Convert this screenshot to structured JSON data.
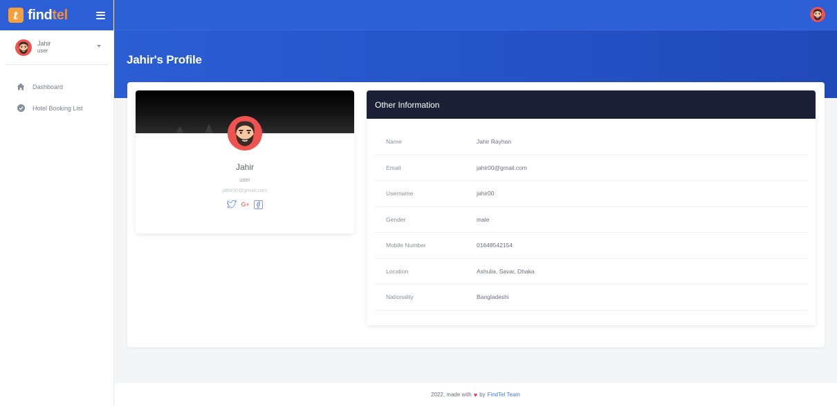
{
  "brand": {
    "logo_letter": "t",
    "name_part1": "find",
    "name_part2": "tel"
  },
  "sidebar": {
    "user": {
      "name": "Jahir",
      "role": "user"
    },
    "items": [
      {
        "label": "Dashboard",
        "icon": "home-icon"
      },
      {
        "label": "Hotel Booking List",
        "icon": "check-circle-icon"
      }
    ]
  },
  "header": {
    "title": "Jahir's Profile"
  },
  "profile": {
    "name": "Jahir",
    "role": "user",
    "email": "jahir00@gmail.com",
    "socials": [
      "twitter-icon",
      "google-plus-icon",
      "facebook-icon"
    ],
    "google_plus_label": "G+"
  },
  "info": {
    "title": "Other Information",
    "rows": [
      {
        "label": "Name",
        "value": "Jahir Rayhan"
      },
      {
        "label": "Email",
        "value": "jahir00@gmail.com"
      },
      {
        "label": "Username",
        "value": "jahir00"
      },
      {
        "label": "Gender",
        "value": "male"
      },
      {
        "label": "Mobile Number",
        "value": "01648542154"
      },
      {
        "label": "Location",
        "value": "Ashulia, Savar, Dhaka"
      },
      {
        "label": "Nationality",
        "value": "Bangladeshi"
      }
    ]
  },
  "footer": {
    "text_before": "2022, made with",
    "text_by": "by",
    "team_link": "FindTel Team"
  },
  "colors": {
    "primary": "#2d5fd6",
    "info_header": "#1b2036",
    "accent_orange": "#f28b3c",
    "heart": "#e8334a",
    "link": "#4a7bd9"
  }
}
